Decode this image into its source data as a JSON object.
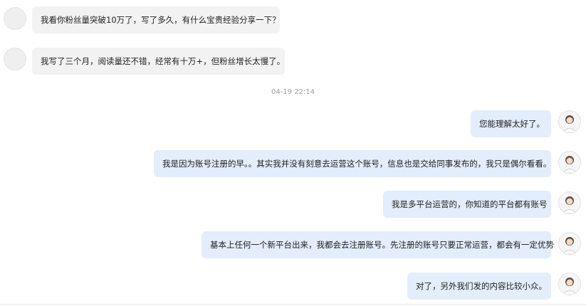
{
  "messages": [
    {
      "side": "incoming",
      "text": "我看你粉丝量突破10万了，写了多久，有什么宝贵经验分享一下？"
    },
    {
      "side": "incoming",
      "text": "我写了三个月，阅读量还不错，经常有十万+，但粉丝增长太慢了。"
    },
    {
      "side": "outgoing",
      "text": "您能理解太好了。"
    },
    {
      "side": "outgoing",
      "text": "我是因为账号注册的早。。其实我并没有刻意去运营这个账号，信息也是交给同事发布的，我只是偶尔看看。"
    },
    {
      "side": "outgoing",
      "text": "我是多平台运营的，你知道的平台都有账号"
    },
    {
      "side": "outgoing",
      "text": "基本上任何一个新平台出来，我都会去注册账号。先注册的账号只要正常运营，都会有一定优势"
    },
    {
      "side": "outgoing",
      "text": "对了，另外我们发的内容比较小众。"
    }
  ],
  "timestamp": "04-19 22:14",
  "colors": {
    "incoming_bubble": "#f2f2f2",
    "outgoing_bubble": "#e3edfb",
    "timestamp_text": "#a0a0a0"
  }
}
